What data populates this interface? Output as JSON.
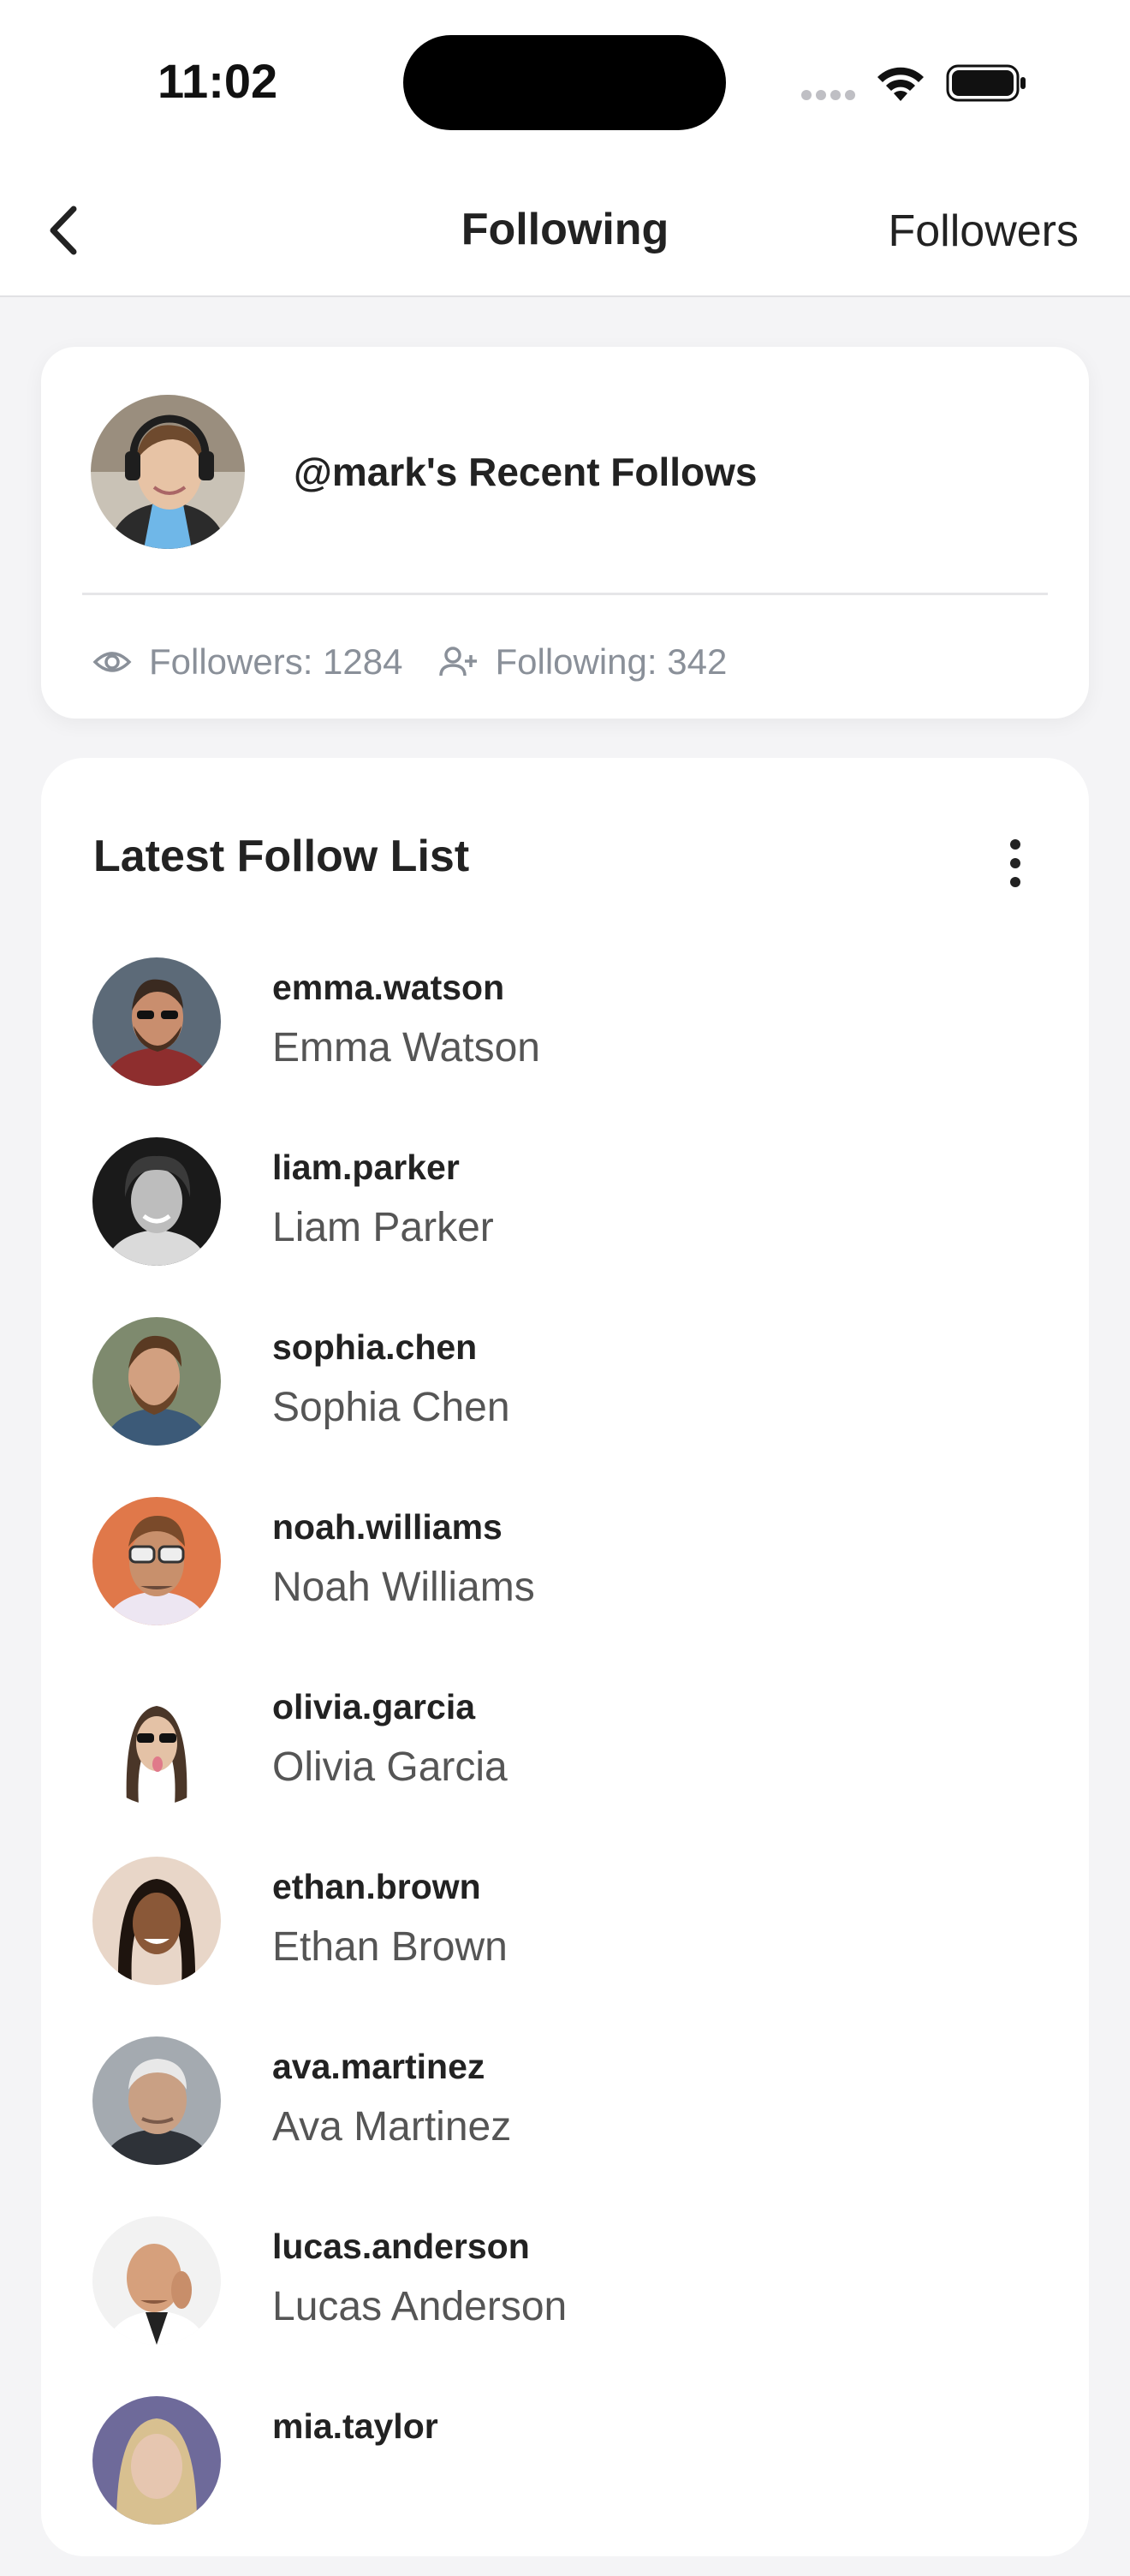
{
  "status_bar": {
    "time": "11:02"
  },
  "nav": {
    "title": "Following",
    "right_link": "Followers",
    "back_icon": "chevron-left-icon"
  },
  "profile": {
    "title": "@mark's Recent Follows",
    "stats": [
      {
        "icon": "eye-icon",
        "label": "Followers: 1284"
      },
      {
        "icon": "user-plus-icon",
        "label": "Following: 342"
      }
    ]
  },
  "list": {
    "title": "Latest Follow List",
    "menu_icon": "more-vertical-icon",
    "items": [
      {
        "username": "emma.watson",
        "name": "Emma Watson"
      },
      {
        "username": "liam.parker",
        "name": "Liam Parker"
      },
      {
        "username": "sophia.chen",
        "name": "Sophia Chen"
      },
      {
        "username": "noah.williams",
        "name": "Noah Williams"
      },
      {
        "username": "olivia.garcia",
        "name": "Olivia Garcia"
      },
      {
        "username": "ethan.brown",
        "name": "Ethan Brown"
      },
      {
        "username": "ava.martinez",
        "name": "Ava Martinez"
      },
      {
        "username": "lucas.anderson",
        "name": "Lucas Anderson"
      },
      {
        "username": "mia.taylor",
        "name": ""
      }
    ]
  },
  "colors": {
    "background": "#F4F4F6",
    "card": "#FFFFFF",
    "muted_text": "#8A9099"
  }
}
